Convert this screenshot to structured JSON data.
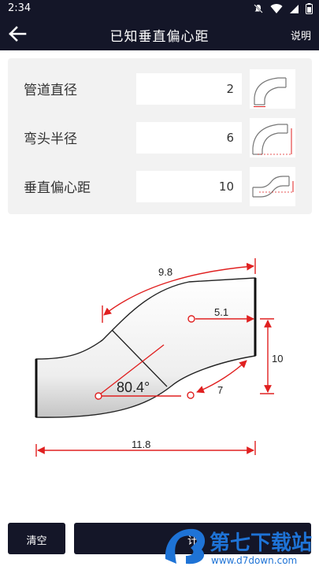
{
  "status": {
    "time": "2:34"
  },
  "appbar": {
    "title": "已知垂直偏心距",
    "help": "说明",
    "back_icon": "arrow-left-icon"
  },
  "inputs": [
    {
      "label": "管道直径",
      "value": "2",
      "icon": "pipe-diameter-diagram"
    },
    {
      "label": "弯头半径",
      "value": "6",
      "icon": "elbow-radius-diagram"
    },
    {
      "label": "垂直偏心距",
      "value": "10",
      "icon": "vertical-offset-diagram"
    }
  ],
  "diagram": {
    "top_length": "9.8",
    "offset_radius": "5.1",
    "vertical_offset": "10",
    "angle": "80.4°",
    "radius": "7",
    "bottom_length": "11.8",
    "accent_color": "#e02020"
  },
  "buttons": {
    "clear": "清空",
    "calculate": "计"
  },
  "watermark": {
    "title": "第七下载站",
    "url": "www.d7down.com"
  }
}
